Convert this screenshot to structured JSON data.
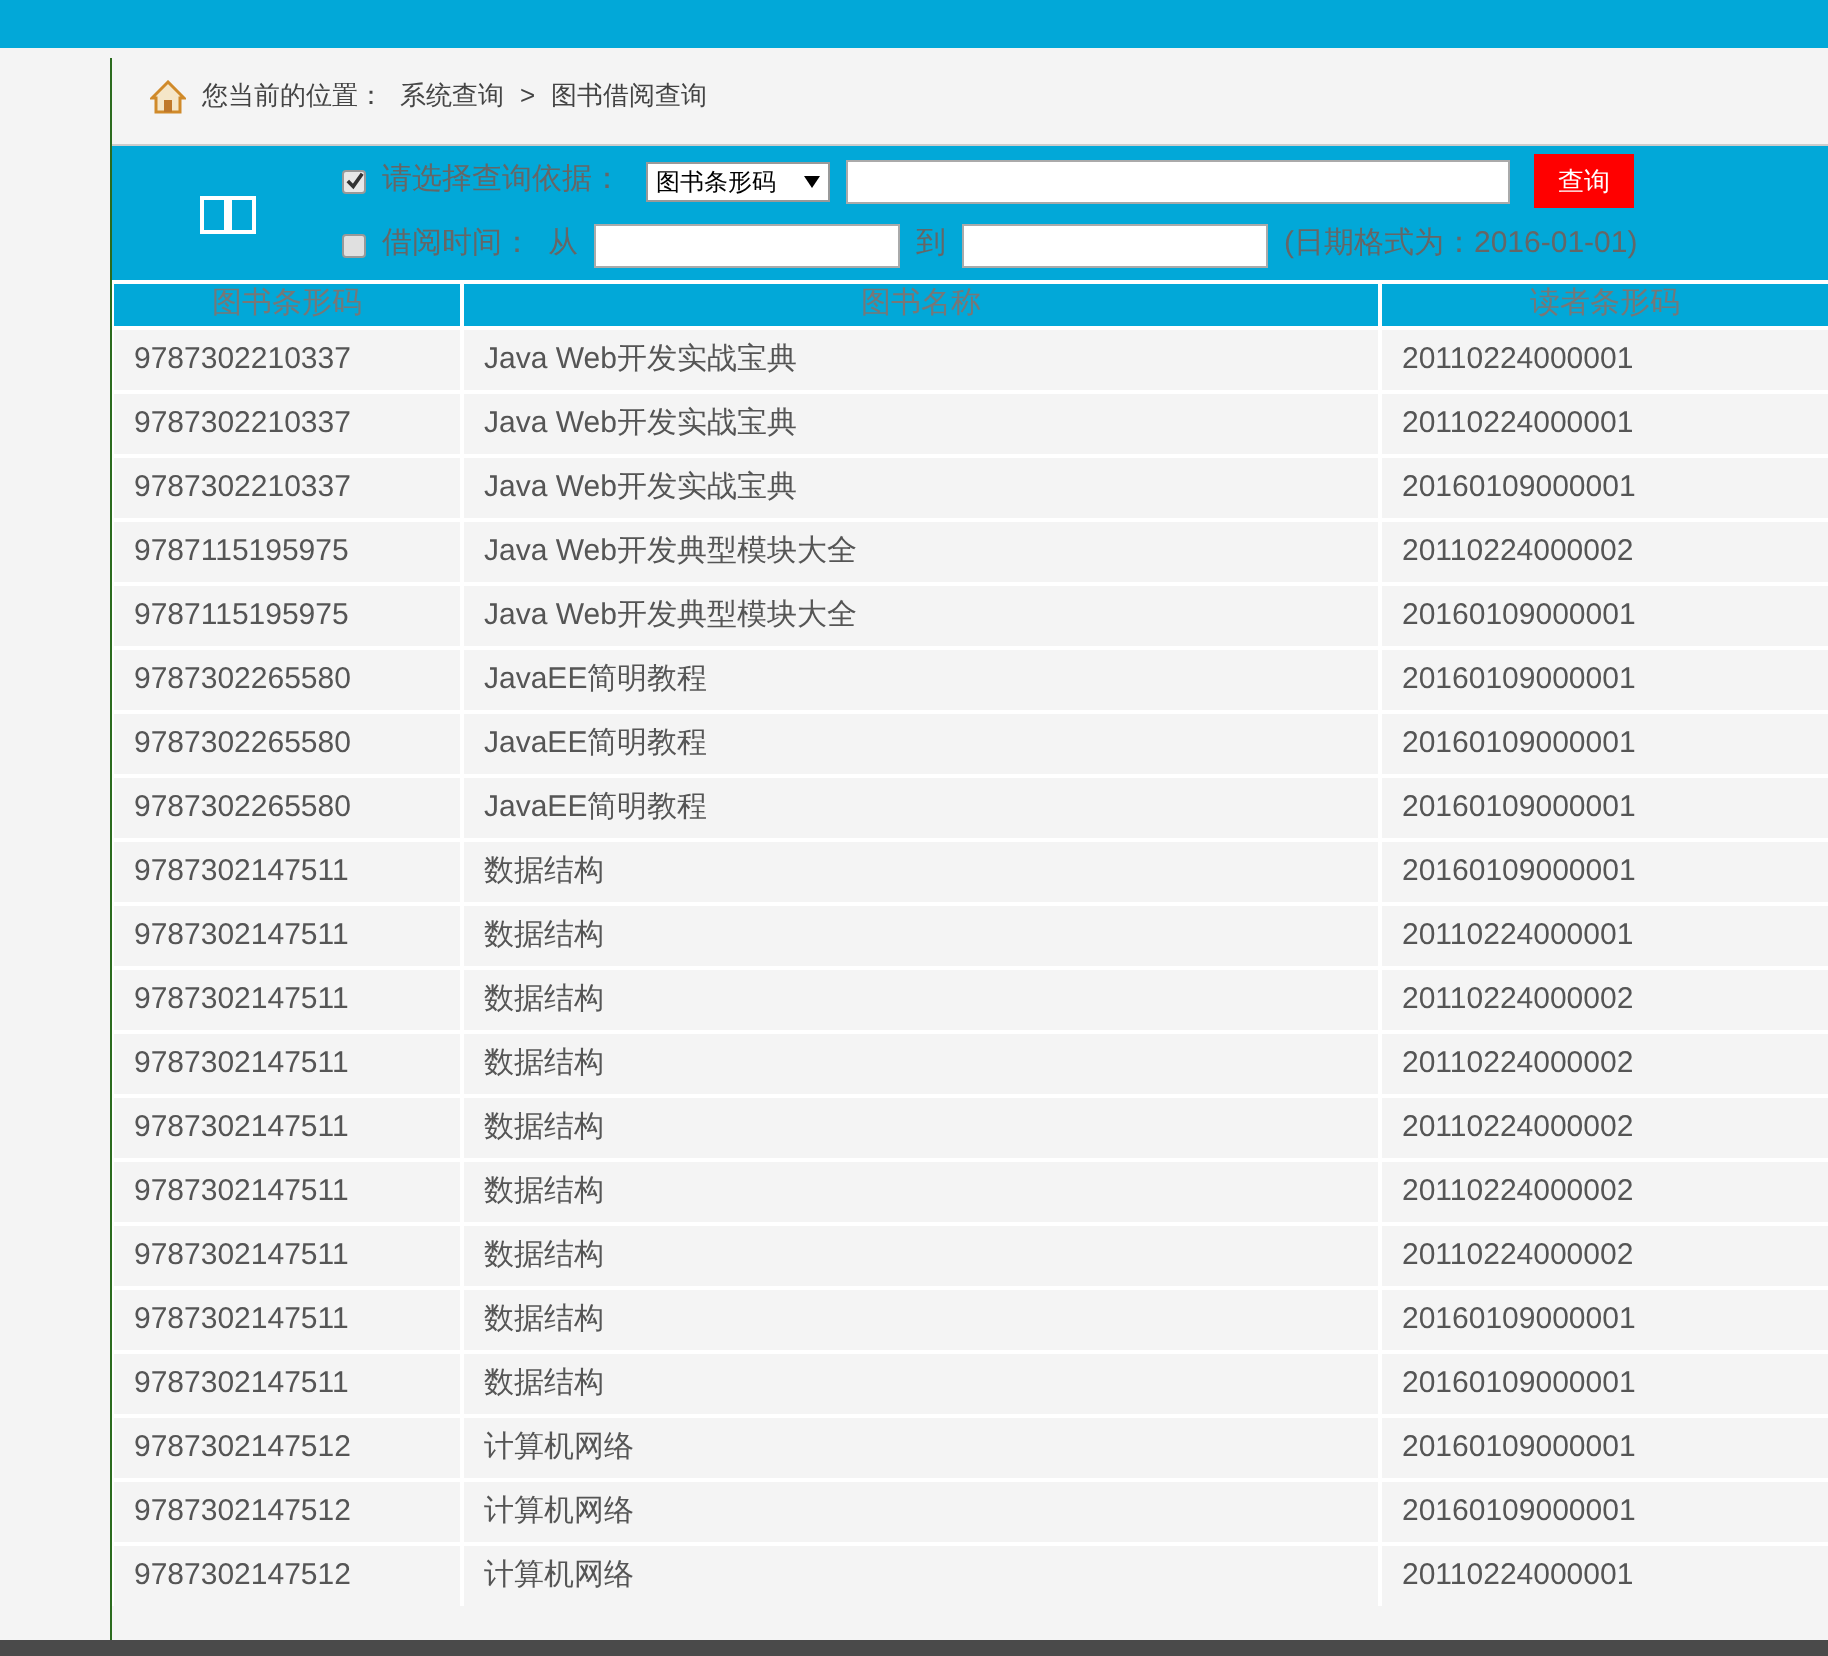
{
  "breadcrumb": {
    "label": "您当前的位置：",
    "path": [
      "系统查询",
      "图书借阅查询"
    ],
    "separator": ">"
  },
  "search": {
    "criterion": {
      "checked": true,
      "label": "请选择查询依据：",
      "select_value": "图书条形码"
    },
    "date": {
      "checked": false,
      "label": "借阅时间：",
      "from_label": "从",
      "to_label": "到",
      "hint": "(日期格式为：2016-01-01)"
    },
    "button": "查询"
  },
  "table": {
    "columns": [
      "图书条形码",
      "图书名称",
      "读者条形码"
    ],
    "rows": [
      [
        "9787302210337",
        "Java Web开发实战宝典",
        "20110224000001"
      ],
      [
        "9787302210337",
        "Java Web开发实战宝典",
        "20110224000001"
      ],
      [
        "9787302210337",
        "Java Web开发实战宝典",
        "20160109000001"
      ],
      [
        "9787115195975",
        "Java Web开发典型模块大全",
        "20110224000002"
      ],
      [
        "9787115195975",
        "Java Web开发典型模块大全",
        "20160109000001"
      ],
      [
        "9787302265580",
        "JavaEE简明教程",
        "20160109000001"
      ],
      [
        "9787302265580",
        "JavaEE简明教程",
        "20160109000001"
      ],
      [
        "9787302265580",
        "JavaEE简明教程",
        "20160109000001"
      ],
      [
        "9787302147511",
        "数据结构",
        "20160109000001"
      ],
      [
        "9787302147511",
        "数据结构",
        "20110224000001"
      ],
      [
        "9787302147511",
        "数据结构",
        "20110224000002"
      ],
      [
        "9787302147511",
        "数据结构",
        "20110224000002"
      ],
      [
        "9787302147511",
        "数据结构",
        "20110224000002"
      ],
      [
        "9787302147511",
        "数据结构",
        "20110224000002"
      ],
      [
        "9787302147511",
        "数据结构",
        "20110224000002"
      ],
      [
        "9787302147511",
        "数据结构",
        "20160109000001"
      ],
      [
        "9787302147511",
        "数据结构",
        "20160109000001"
      ],
      [
        "9787302147512",
        "计算机网络",
        "20160109000001"
      ],
      [
        "9787302147512",
        "计算机网络",
        "20160109000001"
      ],
      [
        "9787302147512",
        "计算机网络",
        "20110224000001"
      ]
    ]
  }
}
